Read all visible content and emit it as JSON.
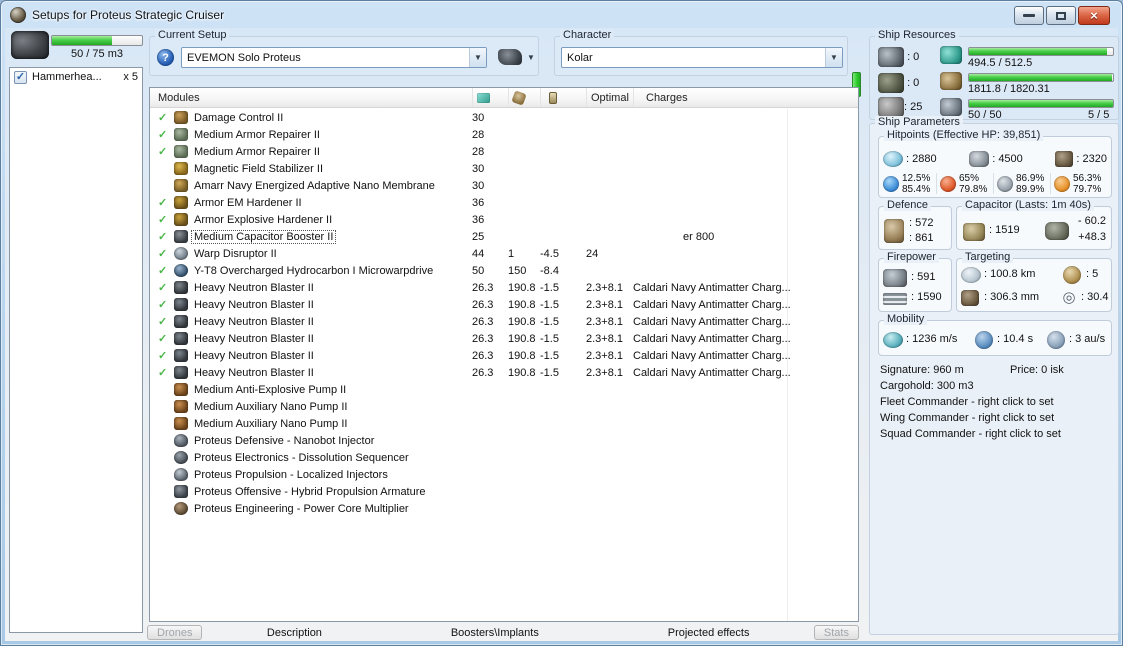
{
  "window": {
    "title": "Setups for Proteus Strategic Cruiser"
  },
  "drone_panel": {
    "capacity_text": "50 / 75 m3",
    "bar_pct": 67,
    "item": {
      "checked": true,
      "check_glyph": "✓",
      "label": "Hammerhea...",
      "qty": "x 5"
    }
  },
  "current_setup": {
    "label": "Current Setup",
    "value": "EVEMON Solo Proteus",
    "help_glyph": "?"
  },
  "character": {
    "label": "Character",
    "value": "Kolar"
  },
  "ship_resources": {
    "label": "Ship Resources",
    "turrets": ": 0",
    "launchers": ": 0",
    "calibration": ": 25",
    "cpu": {
      "text": "494.5 / 512.5",
      "pct": 96
    },
    "powergrid": {
      "text": "1811.8 / 1820.31",
      "pct": 99
    },
    "drones": {
      "text": "50 / 50",
      "bandwidth": "5 / 5",
      "pct": 100
    }
  },
  "modules": {
    "header": {
      "name": "Modules",
      "optimal": "Optimal",
      "charges": "Charges"
    },
    "rows": [
      {
        "fitted": true,
        "icon": "damage-control",
        "name": "Damage Control II",
        "cpu": "30",
        "pg": "",
        "cap": "",
        "optimal": "",
        "charges": ""
      },
      {
        "fitted": true,
        "icon": "armor-repairer",
        "name": "Medium Armor Repairer II",
        "cpu": "28",
        "pg": "",
        "cap": "",
        "optimal": "",
        "charges": ""
      },
      {
        "fitted": true,
        "icon": "armor-repairer",
        "name": "Medium Armor Repairer II",
        "cpu": "28",
        "pg": "",
        "cap": "",
        "optimal": "",
        "charges": ""
      },
      {
        "fitted": false,
        "icon": "mag-stab",
        "name": "Magnetic Field Stabilizer II",
        "cpu": "30",
        "pg": "",
        "cap": "",
        "optimal": "",
        "charges": ""
      },
      {
        "fitted": false,
        "icon": "nano-membrane",
        "name": "Amarr Navy Energized Adaptive Nano Membrane",
        "cpu": "30",
        "pg": "",
        "cap": "",
        "optimal": "",
        "charges": ""
      },
      {
        "fitted": true,
        "icon": "armor-hardener",
        "name": "Armor EM Hardener II",
        "cpu": "36",
        "pg": "",
        "cap": "",
        "optimal": "",
        "charges": ""
      },
      {
        "fitted": true,
        "icon": "armor-hardener",
        "name": "Armor Explosive Hardener II",
        "cpu": "36",
        "pg": "",
        "cap": "",
        "optimal": "",
        "charges": ""
      },
      {
        "fitted": true,
        "icon": "cap-booster",
        "name": "Medium Capacitor Booster II",
        "cpu": "25",
        "pg": "",
        "cap": "",
        "optimal": "",
        "charges": "er 800",
        "selected": true,
        "charges_indent": true
      },
      {
        "fitted": true,
        "icon": "warp-disruptor",
        "name": "Warp Disruptor II",
        "cpu": "44",
        "pg": "1",
        "cap": "-4.5",
        "optimal": "24",
        "charges": ""
      },
      {
        "fitted": true,
        "icon": "mwd",
        "name": "Y-T8 Overcharged Hydrocarbon I Microwarpdrive",
        "cpu": "50",
        "pg": "150",
        "cap": "-8.4",
        "optimal": "",
        "charges": ""
      },
      {
        "fitted": true,
        "icon": "blaster",
        "name": "Heavy Neutron Blaster II",
        "cpu": "26.3",
        "pg": "190.8",
        "cap": "-1.5",
        "optimal": "2.3+8.1",
        "charges": "Caldari Navy Antimatter Charg..."
      },
      {
        "fitted": true,
        "icon": "blaster",
        "name": "Heavy Neutron Blaster II",
        "cpu": "26.3",
        "pg": "190.8",
        "cap": "-1.5",
        "optimal": "2.3+8.1",
        "charges": "Caldari Navy Antimatter Charg..."
      },
      {
        "fitted": true,
        "icon": "blaster",
        "name": "Heavy Neutron Blaster II",
        "cpu": "26.3",
        "pg": "190.8",
        "cap": "-1.5",
        "optimal": "2.3+8.1",
        "charges": "Caldari Navy Antimatter Charg..."
      },
      {
        "fitted": true,
        "icon": "blaster",
        "name": "Heavy Neutron Blaster II",
        "cpu": "26.3",
        "pg": "190.8",
        "cap": "-1.5",
        "optimal": "2.3+8.1",
        "charges": "Caldari Navy Antimatter Charg..."
      },
      {
        "fitted": true,
        "icon": "blaster",
        "name": "Heavy Neutron Blaster II",
        "cpu": "26.3",
        "pg": "190.8",
        "cap": "-1.5",
        "optimal": "2.3+8.1",
        "charges": "Caldari Navy Antimatter Charg..."
      },
      {
        "fitted": true,
        "icon": "blaster",
        "name": "Heavy Neutron Blaster II",
        "cpu": "26.3",
        "pg": "190.8",
        "cap": "-1.5",
        "optimal": "2.3+8.1",
        "charges": "Caldari Navy Antimatter Charg..."
      },
      {
        "fitted": false,
        "icon": "rig-pump",
        "name": "Medium Anti-Explosive Pump II",
        "cpu": "",
        "pg": "",
        "cap": "",
        "optimal": "",
        "charges": ""
      },
      {
        "fitted": false,
        "icon": "rig-pump",
        "name": "Medium Auxiliary Nano Pump II",
        "cpu": "",
        "pg": "",
        "cap": "",
        "optimal": "",
        "charges": ""
      },
      {
        "fitted": false,
        "icon": "rig-pump",
        "name": "Medium Auxiliary Nano Pump II",
        "cpu": "",
        "pg": "",
        "cap": "",
        "optimal": "",
        "charges": ""
      },
      {
        "fitted": false,
        "icon": "sub-defensive",
        "name": "Proteus Defensive - Nanobot Injector",
        "cpu": "",
        "pg": "",
        "cap": "",
        "optimal": "",
        "charges": ""
      },
      {
        "fitted": false,
        "icon": "sub-electronics",
        "name": "Proteus Electronics - Dissolution Sequencer",
        "cpu": "",
        "pg": "",
        "cap": "",
        "optimal": "",
        "charges": ""
      },
      {
        "fitted": false,
        "icon": "sub-propulsion",
        "name": "Proteus Propulsion - Localized Injectors",
        "cpu": "",
        "pg": "",
        "cap": "",
        "optimal": "",
        "charges": ""
      },
      {
        "fitted": false,
        "icon": "sub-offensive",
        "name": "Proteus Offensive - Hybrid Propulsion Armature",
        "cpu": "",
        "pg": "",
        "cap": "",
        "optimal": "",
        "charges": ""
      },
      {
        "fitted": false,
        "icon": "sub-engineering",
        "name": "Proteus Engineering - Power Core Multiplier",
        "cpu": "",
        "pg": "",
        "cap": "",
        "optimal": "",
        "charges": ""
      }
    ]
  },
  "bottom_bar": {
    "drones_button": "Drones",
    "tabs": [
      "Description",
      "Boosters\\Implants",
      "Projected effects"
    ],
    "stats_button": "Stats"
  },
  "ship_parameters": {
    "label": "Ship Parameters",
    "hitpoints": {
      "label": "Hitpoints (Effective HP: 39,851)",
      "shield": ": 2880",
      "armor": ": 4500",
      "structure": ": 2320",
      "resists": [
        {
          "name": "em",
          "top": "12.5%",
          "bottom": "85.4%"
        },
        {
          "name": "thermal",
          "top": "65%",
          "bottom": "79.8%"
        },
        {
          "name": "kinetic",
          "top": "86.9%",
          "bottom": "89.9%"
        },
        {
          "name": "explosive",
          "top": "56.3%",
          "bottom": "79.7%"
        }
      ]
    },
    "defence": {
      "label": "Defence",
      "value1": ": 572",
      "value2": ": 861"
    },
    "capacitor": {
      "label": "Capacitor (Lasts: 1m 40s)",
      "amount": ": 1519",
      "delta_top": "- 60.2",
      "delta_bottom": "+48.3"
    },
    "firepower": {
      "label": "Firepower",
      "turret": ": 591",
      "dps": ": 1590"
    },
    "targeting": {
      "label": "Targeting",
      "range": ": 100.8 km",
      "max_targets": ": 5",
      "signature_res": ": 306.3 mm",
      "scan_res": ": 30.4"
    },
    "mobility": {
      "label": "Mobility",
      "speed": ": 1236 m/s",
      "align": ": 10.4 s",
      "warp": ": 3 au/s"
    },
    "info": {
      "signature": "Signature: 960 m",
      "price": "Price: 0 isk",
      "cargohold": "Cargohold: 300 m3",
      "fleet": "Fleet Commander - right click to set",
      "wing": "Wing Commander - right click to set",
      "squad": "Squad Commander - right click to set"
    }
  },
  "colors": {
    "accent_green": "#2ecc2e",
    "close_red": "#c03a1c",
    "fitted_check": "#49b649"
  }
}
